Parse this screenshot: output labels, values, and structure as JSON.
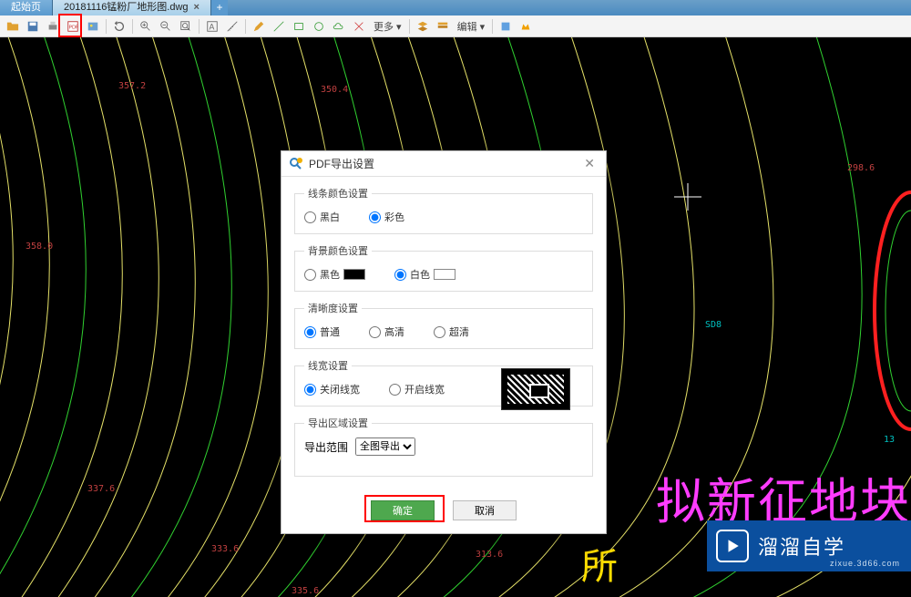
{
  "tabs": {
    "start": "起始页",
    "file": "20181116锰粉厂地形图.dwg"
  },
  "toolbar": {
    "more": "更多",
    "edit": "编辑"
  },
  "dialog": {
    "title": "PDF导出设置",
    "line_color": {
      "legend": "线条颜色设置",
      "opt_bw": "黑白",
      "opt_color": "彩色"
    },
    "bg_color": {
      "legend": "背景颜色设置",
      "opt_black": "黑色",
      "opt_white": "白色"
    },
    "clarity": {
      "legend": "清晰度设置",
      "opt_normal": "普通",
      "opt_hd": "高清",
      "opt_uhd": "超清"
    },
    "line_width": {
      "legend": "线宽设置",
      "opt_off": "关闭线宽",
      "opt_on": "开启线宽"
    },
    "region": {
      "legend": "导出区域设置",
      "range_label": "导出范围",
      "range_value": "全图导出"
    },
    "ok": "确定",
    "cancel": "取消"
  },
  "annotations": {
    "a1": "357.2",
    "a2": "350.4",
    "a3": "298.6",
    "a4": "358.0",
    "a5": "SD8",
    "a6": "337.6",
    "a7": "333.6",
    "a8": "313.6",
    "a9": "335.6",
    "a10": "13"
  },
  "overlay": {
    "magenta": "拟新征地块",
    "yellow": "所"
  },
  "watermark": {
    "brand": "溜溜自学",
    "url": "zixue.3d66.com"
  }
}
